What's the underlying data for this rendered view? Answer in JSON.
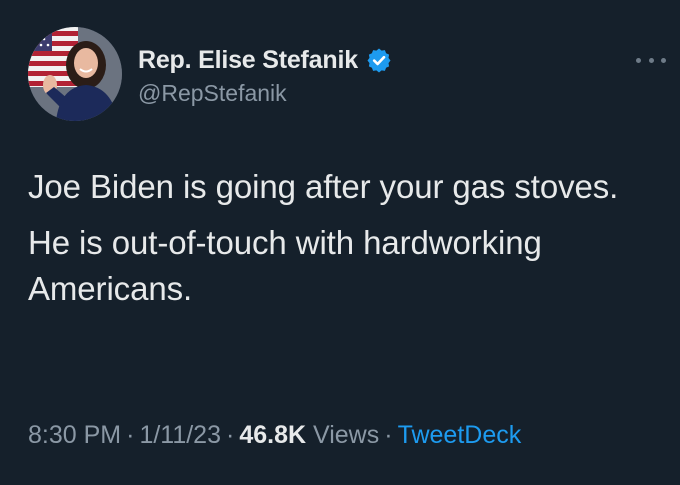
{
  "author": {
    "display_name": "Rep. Elise Stefanik",
    "handle": "@RepStefanik",
    "verified": true,
    "avatar_icon": "profile-photo"
  },
  "tweet": {
    "paragraphs": [
      "Joe Biden is going after your gas stoves.",
      "He is out-of-touch with hardworking Americans."
    ]
  },
  "meta": {
    "time": "8:30 PM",
    "separator": "·",
    "date": "1/11/23",
    "views_count": "46.8K",
    "views_label": "Views",
    "source": "TweetDeck"
  },
  "colors": {
    "background": "#15202b",
    "text": "#e7e9ea",
    "secondary": "#8b98a5",
    "accent": "#1d9bf0"
  }
}
